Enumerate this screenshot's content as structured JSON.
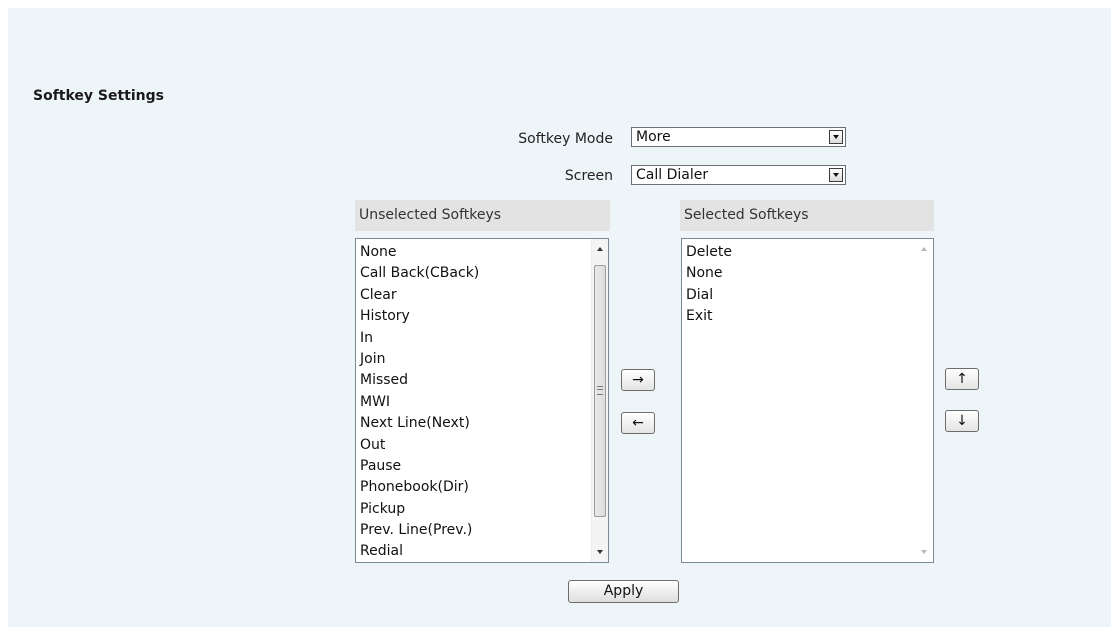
{
  "section": {
    "title": "Softkey Settings"
  },
  "softkey_mode": {
    "label": "Softkey Mode",
    "value": "More"
  },
  "screen": {
    "label": "Screen",
    "value": "Call Dialer"
  },
  "unselected": {
    "header": "Unselected Softkeys",
    "items": [
      "None",
      "Call Back(CBack)",
      "Clear",
      "History",
      "In",
      "Join",
      "Missed",
      "MWI",
      "Next Line(Next)",
      "Out",
      "Pause",
      "Phonebook(Dir)",
      "Pickup",
      "Prev. Line(Prev.)",
      "Redial"
    ]
  },
  "selected": {
    "header": "Selected Softkeys",
    "items": [
      "Delete",
      "None",
      "Dial",
      "Exit"
    ]
  },
  "buttons": {
    "move_right": "→",
    "move_left": "←",
    "move_up": "↑",
    "move_down": "↓",
    "apply": "Apply"
  },
  "icons": {
    "move_right": "arrow-right-icon",
    "move_left": "arrow-left-icon",
    "move_up": "arrow-up-icon",
    "move_down": "arrow-down-icon",
    "dropdown": "chevron-down-icon"
  }
}
